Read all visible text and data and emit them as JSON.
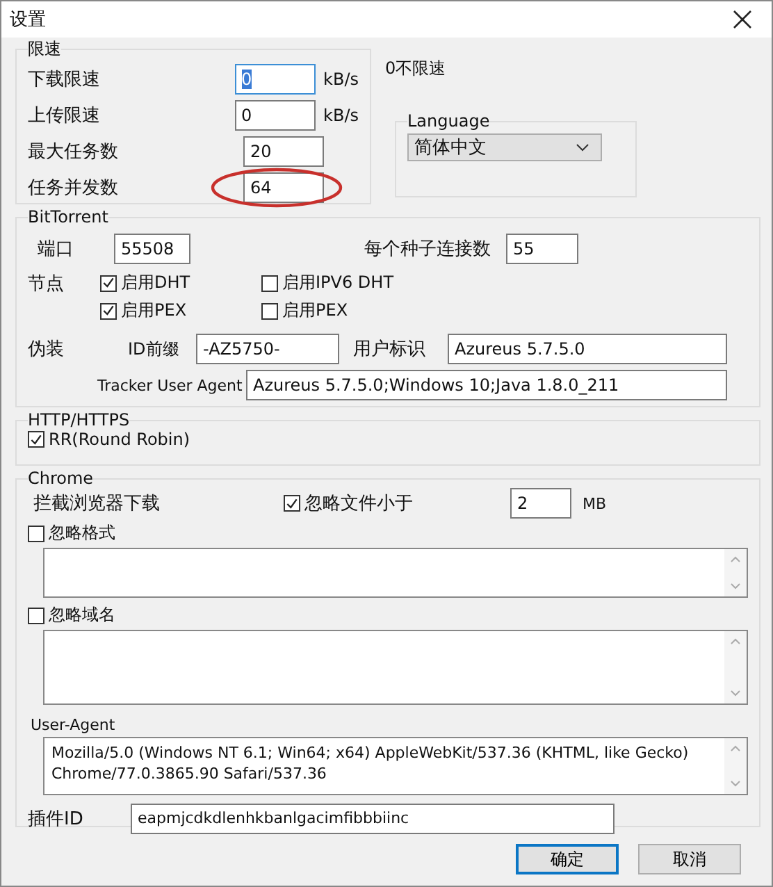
{
  "window": {
    "title": "设置"
  },
  "speed_limit": {
    "title": "限速",
    "rows": [
      {
        "label": "下载限速",
        "value": "0",
        "unit": "kB/s",
        "focused": true,
        "circled": false
      },
      {
        "label": "上传限速",
        "value": "0",
        "unit": "kB/s",
        "focused": false,
        "circled": false
      },
      {
        "label": "最大任务数",
        "value": "20",
        "focused": false,
        "circled": false
      },
      {
        "label": "任务并发数",
        "value": "64",
        "focused": false,
        "circled": true
      }
    ],
    "note": "0不限速"
  },
  "language": {
    "title": "Language",
    "value": "简体中文"
  },
  "bittorrent": {
    "title": "BitTorrent",
    "port_label": "端口",
    "port": "55508",
    "connections_label": "每个种子连接数",
    "connections": "55",
    "nodes_label": "节点",
    "checkboxes": [
      {
        "label": "启用DHT",
        "checked": true
      },
      {
        "label": "启用IPV6 DHT",
        "checked": false
      },
      {
        "label": "启用PEX",
        "checked": true
      },
      {
        "label": "启用PEX",
        "checked": false
      }
    ],
    "disguise_label": "伪装",
    "id_prefix_label": "ID前缀",
    "id_prefix": "-AZ5750-",
    "user_id_label": "用户标识",
    "user_id": "Azureus 5.7.5.0",
    "tracker_label": "Tracker User Agent",
    "tracker": "Azureus 5.7.5.0;Windows 10;Java 1.8.0_211"
  },
  "http": {
    "title": "HTTP/HTTPS",
    "checkbox": {
      "label": "RR(Round Robin)",
      "checked": true
    }
  },
  "chrome": {
    "title": "Chrome",
    "intercept_label": "拦截浏览器下载",
    "ignore_size": {
      "label": "忽略文件小于",
      "checked": true
    },
    "size": "2",
    "size_unit": "MB",
    "ignore_formats": {
      "label": "忽略格式",
      "checked": false
    },
    "ignore_domains": {
      "label": "忽略域名",
      "checked": false
    },
    "user_agent_title": "User-Agent",
    "user_agent": "Mozilla/5.0 (Windows NT 6.1; Win64; x64) AppleWebKit/537.36 (KHTML, like Gecko) Chrome/77.0.3865.90 Safari/537.36",
    "plugin_label": "插件ID",
    "plugin_id": "eapmjcdkdlenhkbanlgacimfibbbiinc"
  },
  "buttons": [
    {
      "label": "确定",
      "default": true
    },
    {
      "label": "取消",
      "default": false
    }
  ]
}
